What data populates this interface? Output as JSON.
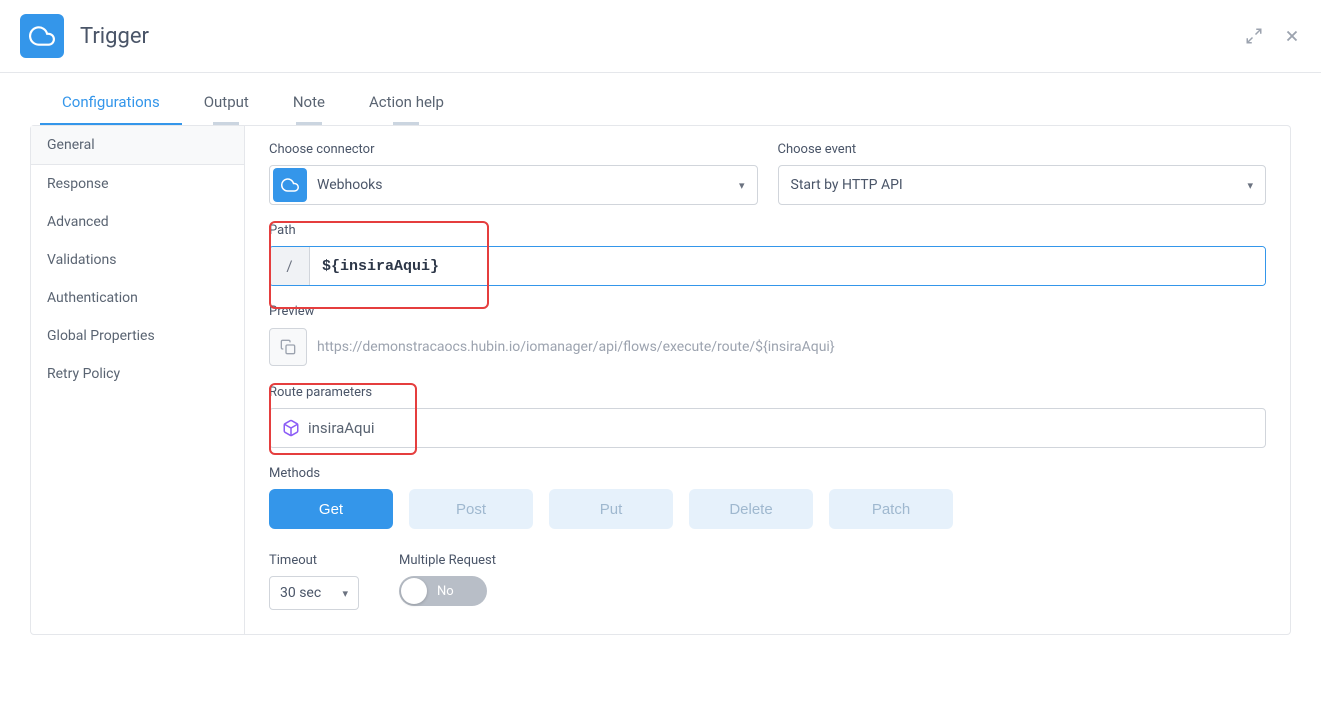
{
  "header": {
    "title": "Trigger"
  },
  "tabs": [
    {
      "label": "Configurations",
      "active": true
    },
    {
      "label": "Output",
      "underline": true
    },
    {
      "label": "Note",
      "underline": true
    },
    {
      "label": "Action help",
      "underline": true
    }
  ],
  "sidebar": {
    "items": [
      {
        "label": "General",
        "active": true
      },
      {
        "label": "Response"
      },
      {
        "label": "Advanced"
      },
      {
        "label": "Validations"
      },
      {
        "label": "Authentication"
      },
      {
        "label": "Global Properties"
      },
      {
        "label": "Retry Policy"
      }
    ]
  },
  "form": {
    "connector": {
      "label": "Choose connector",
      "value": "Webhooks"
    },
    "event": {
      "label": "Choose event",
      "value": "Start by HTTP API"
    },
    "path": {
      "label": "Path",
      "prefix": "/",
      "value": "${insiraAqui}"
    },
    "preview": {
      "label": "Preview",
      "url": "https://demonstracaocs.hubin.io/iomanager/api/flows/execute/route/${insiraAqui}"
    },
    "routeParams": {
      "label": "Route parameters",
      "value": "insiraAqui"
    },
    "methods": {
      "label": "Methods",
      "items": [
        {
          "label": "Get",
          "active": true
        },
        {
          "label": "Post"
        },
        {
          "label": "Put"
        },
        {
          "label": "Delete"
        },
        {
          "label": "Patch"
        }
      ]
    },
    "timeout": {
      "label": "Timeout",
      "value": "30 sec"
    },
    "multipleRequest": {
      "label": "Multiple Request",
      "value": "No",
      "on": false
    }
  }
}
